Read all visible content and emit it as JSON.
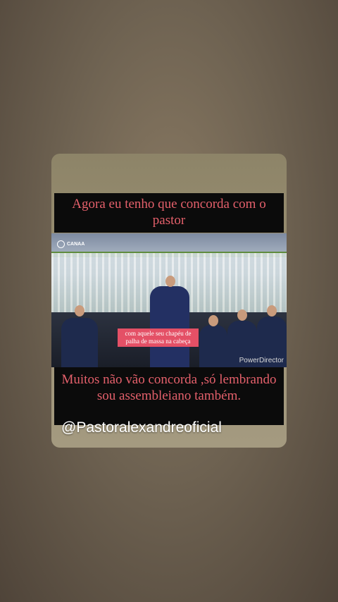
{
  "post": {
    "caption_top": "Agora eu tenho que concorda com o pastor",
    "caption_bottom": "Muitos não vão concorda ,só lembrando sou assembleiano também.",
    "video_logo_text": "CANAA",
    "video_overlay_label": "com aquele seu chapéu de palha de massa na cabeça",
    "video_watermark": "PowerDirector",
    "handle": "@Pastoralexandreoficial"
  },
  "colors": {
    "caption_text": "#e4606b",
    "caption_bg": "#0b0b0b",
    "overlay_label_bg": "#e45066"
  }
}
